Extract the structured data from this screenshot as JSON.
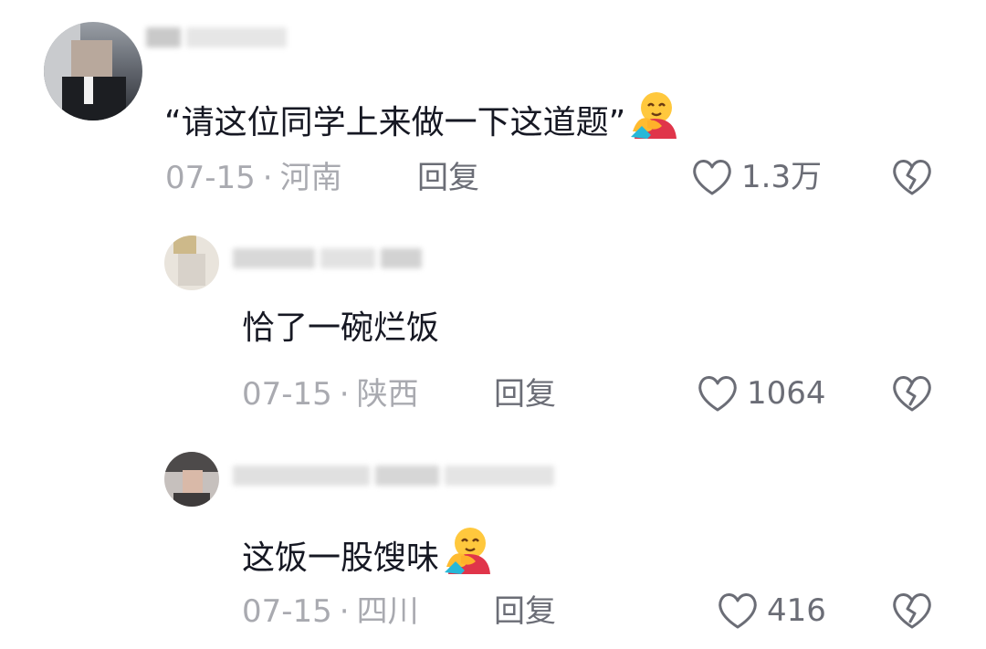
{
  "comments": [
    {
      "text": "“请这位同学上来做一下这道题”",
      "emoji": "hugging-face-icon",
      "date": "07-15",
      "separator": "·",
      "location": "河南",
      "reply_label": "回复",
      "likes": "1.3万"
    },
    {
      "text": "恰了一碗烂饭",
      "date": "07-15",
      "separator": "·",
      "location": "陕西",
      "reply_label": "回复",
      "likes": "1064"
    },
    {
      "text": "这饭一股馊味",
      "emoji": "hugging-face-icon",
      "date": "07-15",
      "separator": "·",
      "location": "四川",
      "reply_label": "回复",
      "likes": "416"
    }
  ],
  "colors": {
    "text": "#161823",
    "meta": "#a9aab0",
    "action": "#6b6d76"
  }
}
